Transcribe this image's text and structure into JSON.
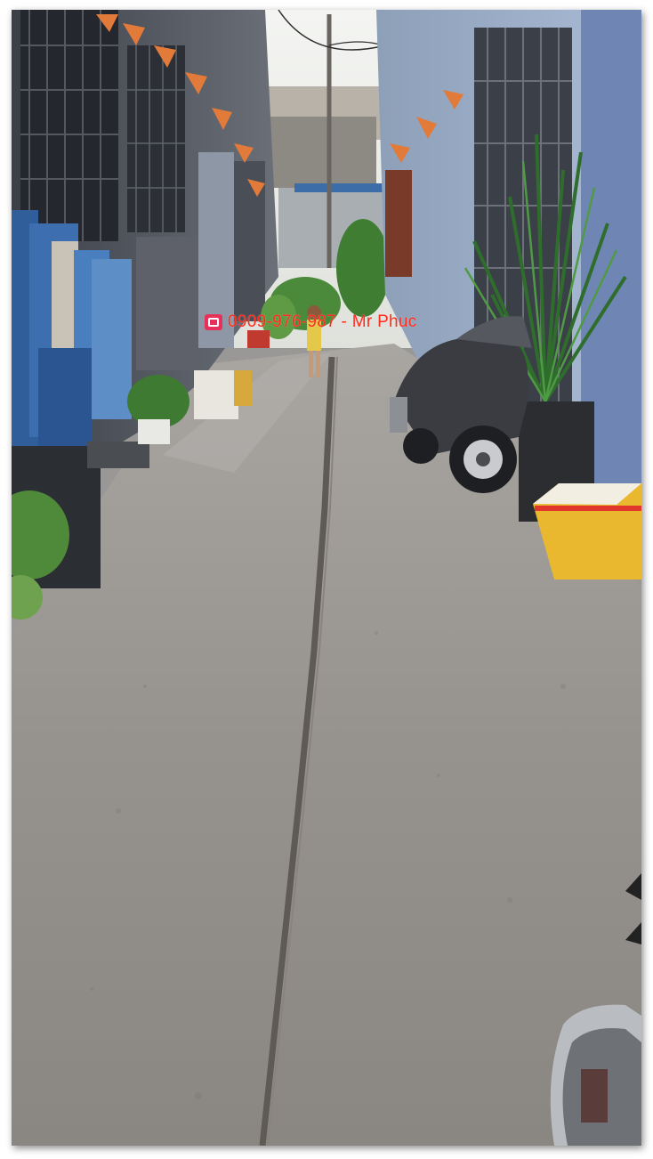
{
  "photo": {
    "subject": "alley",
    "watermark": {
      "phone": "0909-976-987",
      "separator": " - ",
      "name": "Mr Phuc",
      "color": "#ff2a1a",
      "icon": "phone-icon"
    }
  }
}
